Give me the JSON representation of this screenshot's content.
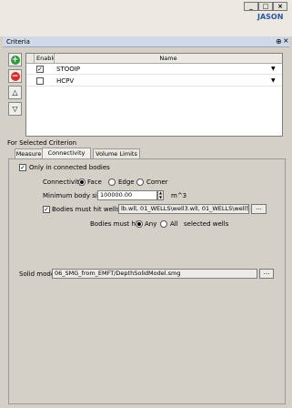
{
  "window": {
    "buttons": [
      "_",
      "□",
      "×"
    ],
    "brand": "JASON"
  },
  "panel": {
    "title": "Criteria",
    "pin_glyph": "⊕",
    "close_glyph": "×"
  },
  "side_buttons": [
    {
      "name": "add",
      "glyph": "+",
      "color": "#2e9a3a"
    },
    {
      "name": "remove",
      "glyph": "−",
      "color": "#d23030"
    },
    {
      "name": "move-up",
      "glyph": "△"
    },
    {
      "name": "move-down",
      "glyph": "▽"
    }
  ],
  "table": {
    "headers": {
      "enable": "Enable",
      "name": "Name"
    },
    "rows": [
      {
        "enabled": "✓",
        "name": "STOOIP",
        "arrow": "▼"
      },
      {
        "enabled": "",
        "name": "HCPV",
        "arrow": "▼"
      }
    ]
  },
  "section": {
    "label": "For Selected Criterion"
  },
  "tabs": [
    {
      "label": "Measure"
    },
    {
      "label": "Connectivity"
    },
    {
      "label": "Volume Limits"
    }
  ],
  "connectivity": {
    "only_connected_label": "Only in connected bodies",
    "only_connected_checked": "✓",
    "connectivity_label": "Connectivity",
    "conn_options": [
      "Face",
      "Edge",
      "Corner"
    ],
    "conn_selected": "Face",
    "min_body_label": "Minimum body size",
    "min_body_value": "100000.00",
    "min_body_unit": "m^3",
    "hit_wells_label": "Bodies must hit wells",
    "hit_wells_checked": "✓",
    "hit_wells_value": "lb.wll, 01_WELLS\\well3.wll, 01_WELLS\\well5.wll",
    "browse_label": "...",
    "must_hit_label": "Bodies must hit",
    "must_hit_options": [
      "Any",
      "All"
    ],
    "must_hit_selected": "Any",
    "must_hit_suffix": "selected wells",
    "solid_model_label": "Solid model",
    "solid_model_value": "06_SMG_from_EMFT/DepthSolidModel.smg",
    "solid_browse_label": "..."
  }
}
